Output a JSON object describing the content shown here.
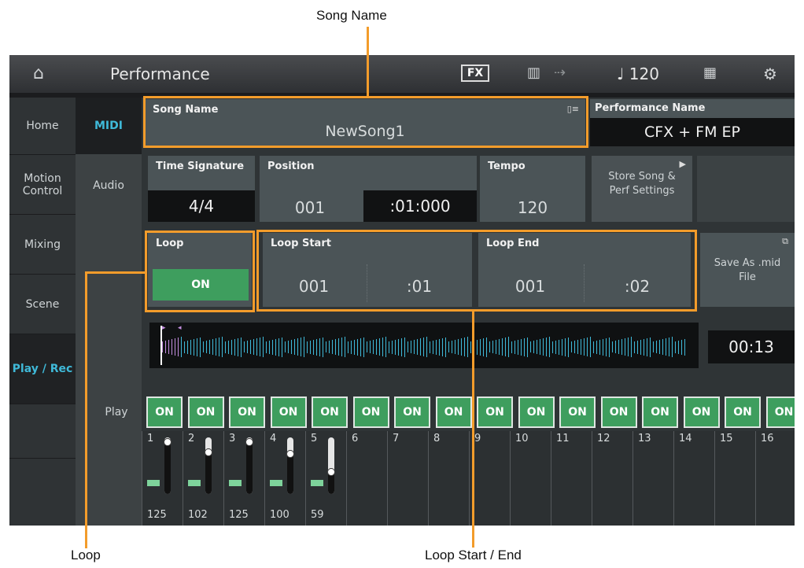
{
  "callouts": {
    "song_name": "Song Name",
    "loop": "Loop",
    "loop_start_end": "Loop Start / End"
  },
  "topbar": {
    "title": "Performance",
    "fx_label": "FX",
    "tempo_display": "♩ 120"
  },
  "sidenav": {
    "items": [
      {
        "label": "Home"
      },
      {
        "label": "Motion Control"
      },
      {
        "label": "Mixing"
      },
      {
        "label": "Scene"
      },
      {
        "label": "Play / Rec",
        "active": true
      }
    ]
  },
  "subnav": {
    "midi": "MIDI",
    "audio": "Audio"
  },
  "song_name": {
    "title": "Song Name",
    "value": "NewSong1"
  },
  "performance_name": {
    "title": "Performance Name",
    "value": "CFX + FM EP"
  },
  "time_signature": {
    "title": "Time Signature",
    "value": "4/4"
  },
  "position": {
    "title": "Position",
    "measure": "001",
    "beat": ":01:000"
  },
  "tempo": {
    "title": "Tempo",
    "value": "120"
  },
  "store_button": {
    "label": "Store Song & Perf Settings"
  },
  "loop": {
    "title": "Loop",
    "state": "ON"
  },
  "loop_start": {
    "title": "Loop Start",
    "measure": "001",
    "beat": ":01"
  },
  "loop_end": {
    "title": "Loop End",
    "measure": "001",
    "beat": ":02"
  },
  "save_as": {
    "label": "Save As .mid File"
  },
  "time_display": "00:13",
  "play_row": {
    "label": "Play",
    "states": [
      "ON",
      "ON",
      "ON",
      "ON",
      "ON",
      "ON",
      "ON",
      "ON",
      "ON",
      "ON",
      "ON",
      "ON",
      "ON",
      "ON",
      "ON",
      "ON"
    ]
  },
  "channels": [
    {
      "num": "1",
      "value": "125",
      "level": 0.98
    },
    {
      "num": "2",
      "value": "102",
      "level": 0.8
    },
    {
      "num": "3",
      "value": "125",
      "level": 0.98
    },
    {
      "num": "4",
      "value": "100",
      "level": 0.78
    },
    {
      "num": "5",
      "value": "59",
      "level": 0.46
    },
    {
      "num": "6"
    },
    {
      "num": "7"
    },
    {
      "num": "8"
    },
    {
      "num": "9"
    },
    {
      "num": "10"
    },
    {
      "num": "11"
    },
    {
      "num": "12"
    },
    {
      "num": "13"
    },
    {
      "num": "14"
    },
    {
      "num": "15"
    },
    {
      "num": "16"
    }
  ],
  "colors": {
    "accent": "#3fb9d8",
    "on_green": "#3e9e5e",
    "callout": "#f39c2b"
  }
}
